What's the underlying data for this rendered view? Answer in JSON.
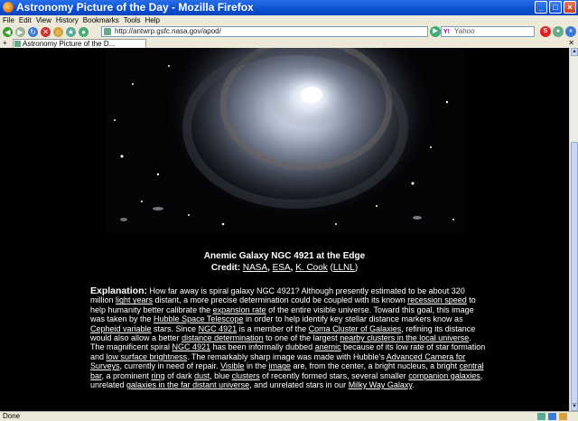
{
  "window": {
    "title": "Astronomy Picture of the Day - Mozilla Firefox"
  },
  "menu": [
    "File",
    "Edit",
    "View",
    "History",
    "Bookmarks",
    "Tools",
    "Help"
  ],
  "navbar": {
    "url": "http://antwrp.gsfc.nasa.gov/apod/",
    "search_placeholder": "Yahoo"
  },
  "tab": {
    "label": "Astronomy Picture of the D..."
  },
  "caption": {
    "title": "Anemic Galaxy NGC 4921 at the Edge",
    "credit_label": "Credit:",
    "credits": [
      "NASA",
      "ESA",
      "K. Cook",
      "LLNL"
    ]
  },
  "explanation": {
    "lead": "Explanation:",
    "segments": [
      {
        "t": " How far away is spiral galaxy NGC 4921? Although presently estimated to be about 320 million "
      },
      {
        "t": "light years",
        "link": true
      },
      {
        "t": " distant, a more precise determination could be coupled with its known "
      },
      {
        "t": "recession speed",
        "link": true
      },
      {
        "t": " to help humanity better calibrate the "
      },
      {
        "t": "expansion rate",
        "link": true
      },
      {
        "t": " of the entire visible universe. Toward this goal, this image was taken by the "
      },
      {
        "t": "Hubble Space Telescope",
        "link": true
      },
      {
        "t": " in order to help identify key stellar distance markers know as "
      },
      {
        "t": "Cepheid variable",
        "link": true
      },
      {
        "t": " stars. Since "
      },
      {
        "t": "NGC 4921",
        "link": true
      },
      {
        "t": " is a member of the "
      },
      {
        "t": "Coma Cluster of Galaxies",
        "link": true
      },
      {
        "t": ", refining its distance would also allow a better "
      },
      {
        "t": "distance determination",
        "link": true
      },
      {
        "t": " to one of the largest "
      },
      {
        "t": "nearby clusters in the local universe",
        "link": true
      },
      {
        "t": ". The magnificent spiral "
      },
      {
        "t": "NGC 4921",
        "link": true
      },
      {
        "t": " has been informally dubbed "
      },
      {
        "t": "anemic",
        "link": true
      },
      {
        "t": " because of its low rate of star formation and "
      },
      {
        "t": "low surface brightness",
        "link": true
      },
      {
        "t": ". The remarkably sharp image was made with Hubble's "
      },
      {
        "t": "Advanced Camera for Surveys",
        "link": true
      },
      {
        "t": ", currently in need of repair. "
      },
      {
        "t": "Visible",
        "link": true
      },
      {
        "t": " in the "
      },
      {
        "t": "image",
        "link": true
      },
      {
        "t": " are, from the center, a bright nucleus, a bright "
      },
      {
        "t": "central bar",
        "link": true
      },
      {
        "t": ", a prominent "
      },
      {
        "t": "ring",
        "link": true
      },
      {
        "t": " of dark "
      },
      {
        "t": "dust",
        "link": true
      },
      {
        "t": ", blue "
      },
      {
        "t": "clusters",
        "link": true
      },
      {
        "t": " of recently formed stars, several smaller "
      },
      {
        "t": "companion galaxies",
        "link": true
      },
      {
        "t": ", unrelated "
      },
      {
        "t": "galaxies in the far distant universe",
        "link": true
      },
      {
        "t": ", and unrelated stars in our "
      },
      {
        "t": "Milky Way Galaxy",
        "link": true
      },
      {
        "t": "."
      }
    ]
  },
  "status": {
    "text": "Done"
  },
  "colors": {
    "titlebar": "#0A4FD0",
    "content_bg": "#000000",
    "link": "#ffffff"
  }
}
